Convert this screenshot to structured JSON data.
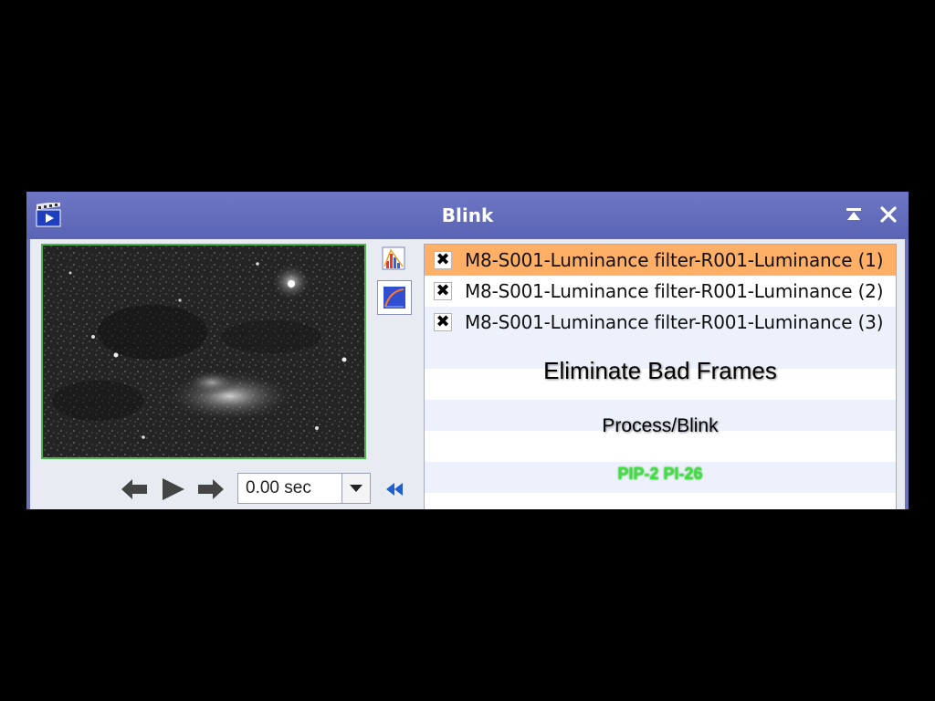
{
  "window": {
    "title": "Blink",
    "icons": {
      "app": "blink-film-icon",
      "minimize": "collapse-up-icon",
      "close": "close-icon"
    }
  },
  "left_panel": {
    "preview_image": "nebula-star-field-preview",
    "tools": [
      "histogram-stretch-icon",
      "auto-stretch-curve-icon"
    ],
    "navigation": {
      "prev_icon": "arrow-left-icon",
      "play_icon": "play-icon",
      "next_icon": "arrow-right-icon",
      "delay_value": "0.00 sec",
      "dropdown_icon": "chevron-down-icon",
      "rewind_icon": "rewind-double-arrow-icon"
    }
  },
  "file_list": {
    "check_mark": "✖",
    "items": [
      {
        "name": "M8-S001-Luminance filter-R001-Luminance (1)",
        "selected": true
      },
      {
        "name": "M8-S001-Luminance filter-R001-Luminance (2)",
        "selected": false
      },
      {
        "name": "M8-S001-Luminance filter-R001-Luminance (3)",
        "selected": false
      }
    ]
  },
  "overlay_text": {
    "heading": "Eliminate Bad Frames",
    "process": "Process/Blink",
    "version": "PIP-2 PI-26"
  },
  "colors": {
    "titlebar": "#5f69b8",
    "selected_row": "#ffb066",
    "preview_border": "#4ab64a",
    "version_text": "#3ee23e"
  }
}
